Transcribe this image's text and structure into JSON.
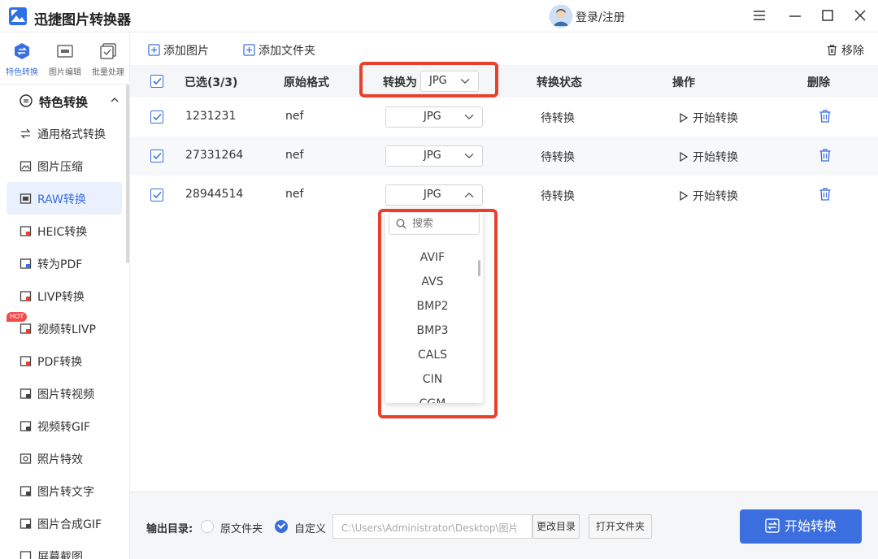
{
  "app": {
    "title": "迅捷图片转换器",
    "login": "登录/注册"
  },
  "topnav": [
    {
      "label": "特色转换",
      "icon": "special-convert-icon"
    },
    {
      "label": "图片编辑",
      "icon": "image-edit-icon"
    },
    {
      "label": "批量处理",
      "icon": "batch-process-icon"
    }
  ],
  "sidebar": {
    "section": "特色转换",
    "hot_badge": "HOT",
    "items": [
      {
        "label": "通用格式转换"
      },
      {
        "label": "图片压缩"
      },
      {
        "label": "RAW转换",
        "active": true
      },
      {
        "label": "HEIC转换"
      },
      {
        "label": "转为PDF"
      },
      {
        "label": "LIVP转换"
      },
      {
        "label": "视频转LIVP",
        "hot": true
      },
      {
        "label": "PDF转换"
      },
      {
        "label": "图片转视频"
      },
      {
        "label": "视频转GIF"
      },
      {
        "label": "照片特效"
      },
      {
        "label": "图片转文字"
      },
      {
        "label": "图片合成GIF"
      },
      {
        "label": "屏幕截图"
      }
    ]
  },
  "toolbar": {
    "add_image": "添加图片",
    "add_folder": "添加文件夹",
    "remove": "移除"
  },
  "table": {
    "headers": {
      "selected": "已选(3/3)",
      "original_format": "原始格式",
      "convert_to": "转换为",
      "convert_to_value": "JPG",
      "status": "转换状态",
      "action": "操作",
      "delete": "删除"
    },
    "rows": [
      {
        "name": "1231231",
        "format": "nef",
        "target": "JPG",
        "status": "待转换",
        "action": "开始转换"
      },
      {
        "name": "27331264",
        "format": "nef",
        "target": "JPG",
        "status": "待转换",
        "action": "开始转换"
      },
      {
        "name": "28944514",
        "format": "nef",
        "target": "JPG",
        "status": "待转换",
        "action": "开始转换"
      }
    ]
  },
  "dropdown": {
    "search_placeholder": "搜索",
    "options": [
      "AVIF",
      "AVS",
      "BMP2",
      "BMP3",
      "CALS",
      "CIN",
      "CGM"
    ]
  },
  "bottom": {
    "output_label": "输出目录:",
    "option_original": "原文件夹",
    "option_custom": "自定义",
    "path": "C:\\Users\\Administrator\\Desktop\\图片",
    "change_dir": "更改目录",
    "open_folder": "打开文件夹",
    "start_all": "开始转换"
  },
  "colors": {
    "accent": "#3b6fe0",
    "highlight": "#e8402a"
  }
}
